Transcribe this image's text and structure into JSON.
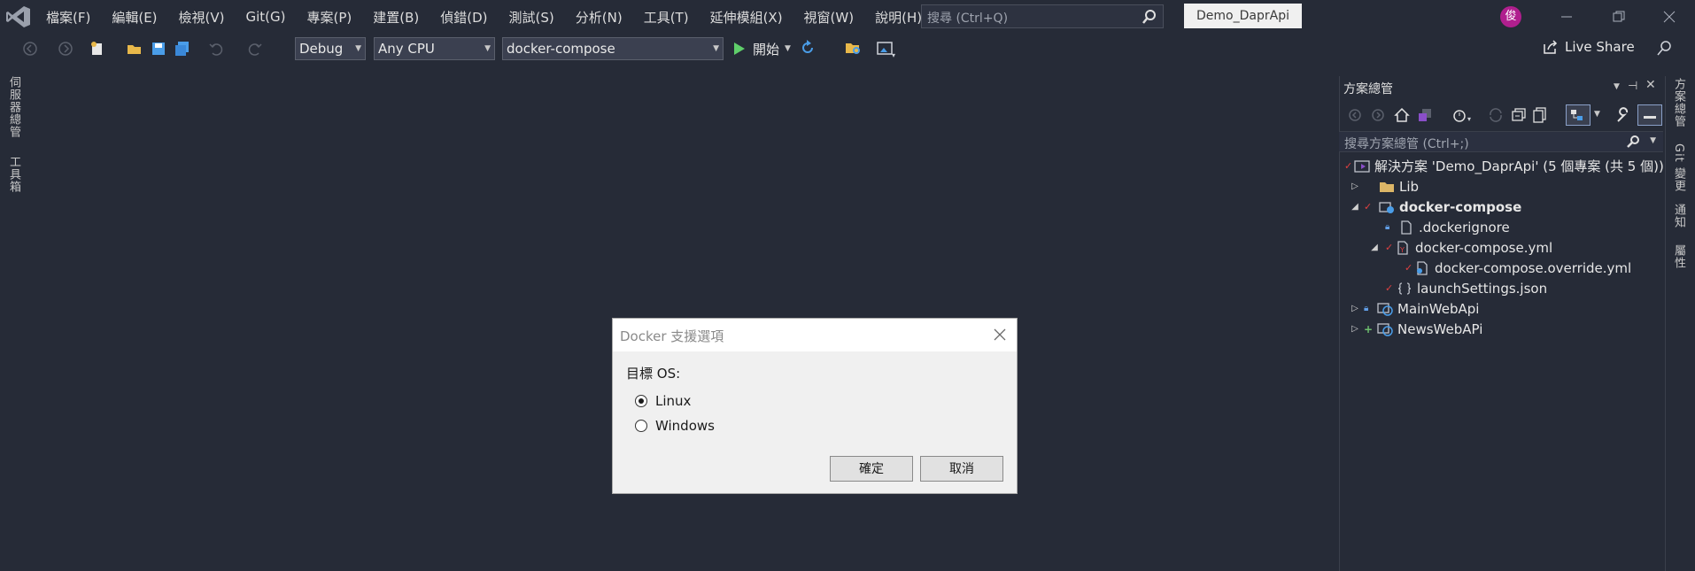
{
  "menu": [
    "檔案(F)",
    "編輯(E)",
    "檢視(V)",
    "Git(G)",
    "專案(P)",
    "建置(B)",
    "偵錯(D)",
    "測試(S)",
    "分析(N)",
    "工具(T)",
    "延伸模組(X)",
    "視窗(W)",
    "說明(H)"
  ],
  "search": {
    "placeholder": "搜尋 (Ctrl+Q)"
  },
  "solution_badge": "Demo_DaprApi",
  "avatar_initial": "俊",
  "toolbar": {
    "config": "Debug",
    "platform": "Any CPU",
    "startup": "docker-compose",
    "start_label": "開始",
    "liveshare_label": "Live Share"
  },
  "left_tabs": [
    "伺服器總管",
    "工具箱"
  ],
  "right_tabs": [
    "方案總管",
    "Git 變更",
    "通知",
    "屬性"
  ],
  "solution_explorer": {
    "title": "方案總管",
    "search_placeholder": "搜尋方案總管 (Ctrl+;)",
    "items": [
      {
        "label": "解決方案 'Demo_DaprApi' (5 個專案 (共 5 個))"
      },
      {
        "label": "Lib"
      },
      {
        "label": "docker-compose"
      },
      {
        "label": ".dockerignore"
      },
      {
        "label": "docker-compose.yml"
      },
      {
        "label": "docker-compose.override.yml"
      },
      {
        "label": "launchSettings.json"
      },
      {
        "label": "MainWebApi"
      },
      {
        "label": "NewsWebAPi"
      }
    ]
  },
  "dialog": {
    "title": "Docker 支援選項",
    "os_label": "目標 OS:",
    "options": [
      "Linux",
      "Windows"
    ],
    "selected": "Linux",
    "ok_label": "確定",
    "cancel_label": "取消"
  }
}
